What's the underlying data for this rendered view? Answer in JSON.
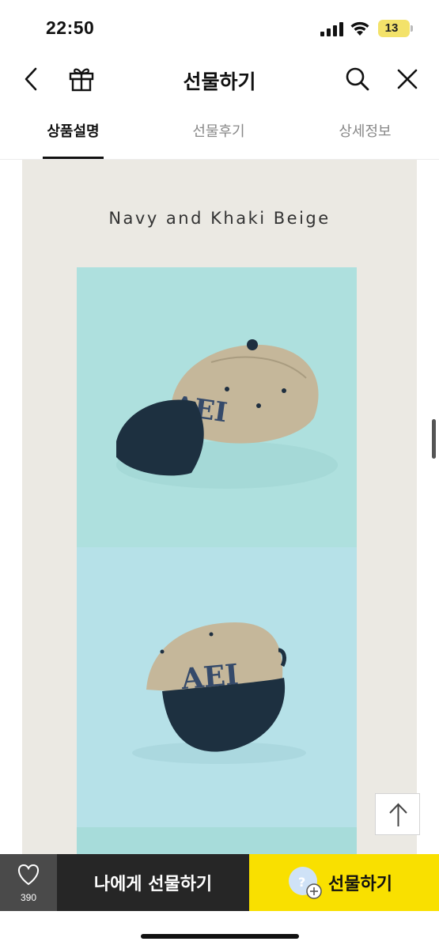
{
  "status_bar": {
    "time": "22:50",
    "battery": "13",
    "icons": [
      "signal-icon",
      "wifi-icon",
      "battery-icon"
    ]
  },
  "nav": {
    "title": "선물하기",
    "icons": [
      "back-icon",
      "gift-icon",
      "search-icon",
      "close-icon"
    ]
  },
  "tabs": [
    {
      "label": "상품설명",
      "active": true
    },
    {
      "label": "선물후기",
      "active": false
    },
    {
      "label": "상세정보",
      "active": false
    }
  ],
  "content": {
    "caption": "Navy and Khaki Beige",
    "cap_logo_text": "AEI"
  },
  "bottom_bar": {
    "like_count": "390",
    "self_gift_label": "나에게 선물하기",
    "gift_label": "선물하기"
  },
  "colors": {
    "accent_yellow": "#f9e000",
    "dark_button": "#262626",
    "like_button": "#4a4a4a",
    "content_bg": "#ebe9e3"
  }
}
